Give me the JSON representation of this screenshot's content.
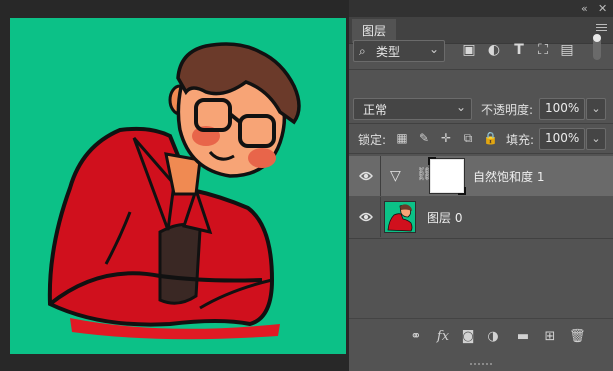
{
  "panel": {
    "tab_label": "图层",
    "filter_kind": "类型",
    "filter_icons": [
      "image-filter-icon",
      "adjustment-filter-icon",
      "type-filter-icon",
      "shape-filter-icon",
      "smart-object-filter-icon"
    ],
    "blend_mode": "正常",
    "opacity_label": "不透明度:",
    "opacity_value": "100%",
    "lock_label": "锁定:",
    "fill_label": "填充:",
    "fill_value": "100%"
  },
  "layers": [
    {
      "name": "自然饱和度 1",
      "type": "adjustment",
      "visible": true,
      "selected": true
    },
    {
      "name": "图层 0",
      "type": "pixel",
      "visible": true,
      "selected": false
    }
  ],
  "bottom_icons": [
    "link-icon",
    "fx-icon",
    "mask-icon",
    "adjustment-icon",
    "folder-icon",
    "new-layer-icon",
    "trash-icon"
  ],
  "colors": {
    "canvas_bg": "#0fc487",
    "panel_bg": "#535353",
    "selected_row": "#6a6a6a",
    "shirt": "#d11020"
  }
}
